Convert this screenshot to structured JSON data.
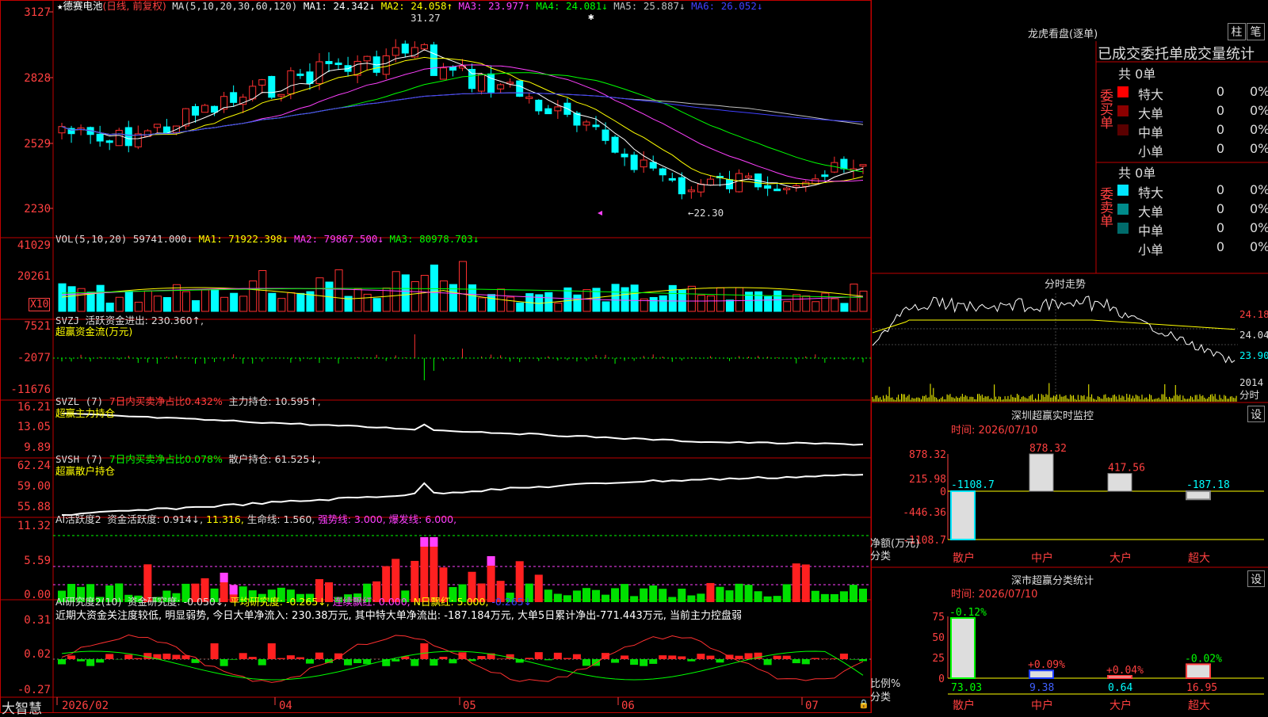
{
  "stock": {
    "star": "★",
    "name": "德赛电池",
    "mode": "(日线, 前复权)"
  },
  "main": {
    "ma_prefix": "MA(5,10,20,30,60,120)",
    "ma": [
      {
        "label": "MA1: 24.342↓",
        "color": "#ffffff"
      },
      {
        "label": "MA2: 24.058↑",
        "color": "#ffff00"
      },
      {
        "label": "MA3: 23.977↑",
        "color": "#ff40ff"
      },
      {
        "label": "MA4: 24.081↓",
        "color": "#00ff00"
      },
      {
        "label": "MA5: 25.887↓",
        "color": "#c0c0c0"
      },
      {
        "label": "MA6: 26.052↓",
        "color": "#4040ff"
      }
    ],
    "high_label": "31.27",
    "low_label": "←22.30",
    "y_ticks": [
      "3127",
      "2828",
      "2529",
      "2230"
    ]
  },
  "vol": {
    "title": "VOL(5,10,20)",
    "value": "59741.000↓",
    "ma": [
      {
        "label": "MA1: 71922.398↓",
        "color": "#ffff00"
      },
      {
        "label": "MA2: 79867.500↓",
        "color": "#ff40ff"
      },
      {
        "label": "MA3: 80978.703↓",
        "color": "#00ff00"
      }
    ],
    "y_ticks": [
      "41029",
      "20261"
    ],
    "unit": "X10"
  },
  "svzj": {
    "title": "SVZJ",
    "item": "活跃资金进出: 230.360↑,",
    "sub": "超赢资金流(万元)",
    "y_ticks": [
      "7521",
      "-2077",
      "-11676"
    ]
  },
  "svzl": {
    "title": "SVZL (7)",
    "ratio": "7日内买卖净占比0.432%",
    "item": "主力持仓: 10.595↑,",
    "sub": "超赢主力持仓",
    "y_ticks": [
      "16.21",
      "13.05",
      "9.89"
    ]
  },
  "svsh": {
    "title": "SVSH (7)",
    "ratio": "7日内买卖净占比0.078%",
    "item": "散户持仓: 61.525↓,",
    "sub": "超赢散户持仓",
    "y_ticks": [
      "62.24",
      "59.00",
      "55.88"
    ]
  },
  "ai2": {
    "title": "AI活跃度2",
    "items": [
      {
        "label": "资金活跃度: 0.914↓,",
        "color": "#dddddd"
      },
      {
        "label": "11.316,",
        "color": "#ffff00"
      },
      {
        "label": "生命线: 1.560,",
        "color": "#dddddd"
      },
      {
        "label": "强势线: 3.000,",
        "color": "#ff40ff"
      },
      {
        "label": "爆发线: 6.000,",
        "color": "#ff40ff"
      }
    ],
    "y_ticks": [
      "11.32",
      "5.59",
      "0.00"
    ]
  },
  "ai_research": {
    "title": "AI研究度2(10)",
    "items": [
      {
        "label": "资金研究度: -0.050↓,",
        "color": "#dddddd"
      },
      {
        "label": "平均研究度: -0.265↓,",
        "color": "#ffff00"
      },
      {
        "label": "连续飘红: 0.000,",
        "color": "#ff40ff"
      },
      {
        "label": "N日飘红: 5.000,",
        "color": "#ffff00"
      },
      {
        "label": "-0.265↓",
        "color": "#4040ff"
      }
    ],
    "comment": "近期大资金关注度较低, 明显弱势, 今日大单净流入: 230.38万元, 其中特大单净流出: -187.184万元, 大单5日累计净出-771.443万元, 当前主力控盘弱",
    "y_ticks": [
      "0.31",
      "0.02",
      "-0.27"
    ]
  },
  "xaxis": {
    "labels": [
      "2026/02",
      "04",
      "05",
      "06",
      "07"
    ],
    "brand": "大智慧"
  },
  "dragon": {
    "title": "龙虎看盘(逐单)",
    "btn1": "柱",
    "btn2": "笔",
    "header": "已成交委托单成交量统计",
    "buy": {
      "side": "委买单",
      "total": "共 0单",
      "rows": [
        {
          "name": "特大",
          "count": "0",
          "pct": "0%",
          "color": "#ff0000"
        },
        {
          "name": "大单",
          "count": "0",
          "pct": "0%",
          "color": "#8b0000"
        },
        {
          "name": "中单",
          "count": "0",
          "pct": "0%",
          "color": "#5a0000"
        },
        {
          "name": "小单",
          "count": "0",
          "pct": "0%",
          "color": ""
        }
      ]
    },
    "sell": {
      "side": "委卖单",
      "total": "共 0单",
      "rows": [
        {
          "name": "特大",
          "count": "0",
          "pct": "0%",
          "color": "#00e5ff"
        },
        {
          "name": "大单",
          "count": "0",
          "pct": "0%",
          "color": "#008b8b"
        },
        {
          "name": "中单",
          "count": "0",
          "pct": "0%",
          "color": "#006b6b"
        },
        {
          "name": "小单",
          "count": "0",
          "pct": "0%",
          "color": ""
        }
      ]
    }
  },
  "intraday": {
    "title": "分时走势",
    "prices": [
      "24.18",
      "24.04",
      "23.90"
    ],
    "vol": "2014",
    "vol_label": "分时"
  },
  "sz_monitor": {
    "title": "深圳超赢实时监控",
    "btn": "设",
    "time": "时间: 2026/07/10",
    "y_ticks": [
      "878.32",
      "215.98",
      "0",
      "-446.36",
      "-1108.7"
    ],
    "ylabel": "净额(万元)",
    "xlabel": "分类",
    "chart_data": {
      "type": "bar",
      "categories": [
        "散户",
        "中户",
        "大户",
        "超大"
      ],
      "values": [
        -1108.7,
        878.32,
        417.56,
        -187.18
      ],
      "value_labels": [
        "-1108.7",
        "878.32",
        "417.56",
        "-187.18"
      ],
      "ylim": [
        -1108.7,
        878.32
      ]
    }
  },
  "sz_class": {
    "title": "深市超赢分类统计",
    "btn": "设",
    "time": "时间: 2026/07/10",
    "y_ticks": [
      "75",
      "50",
      "25",
      "0"
    ],
    "ylabel": "比例%",
    "xlabel": "分类",
    "chart_data": {
      "type": "bar",
      "categories": [
        "散户",
        "中户",
        "大户",
        "超大"
      ],
      "values": [
        73.03,
        9.38,
        0.64,
        16.95
      ],
      "value_labels": [
        "73.03",
        "9.38",
        "0.64",
        "16.95"
      ],
      "change_labels": [
        "-0.12%",
        "+0.09%",
        "+0.04%",
        "-0.02%"
      ],
      "ylim": [
        0,
        75
      ]
    }
  }
}
